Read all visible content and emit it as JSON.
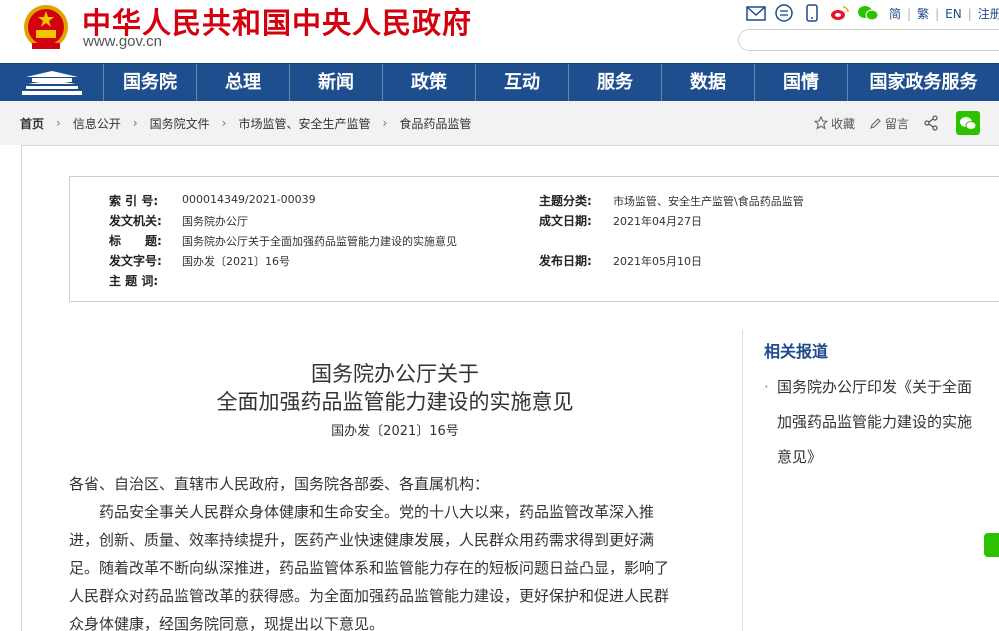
{
  "header": {
    "site_title": "中华人民共和国中央人民政府",
    "site_domain": "www.gov.cn",
    "lang_links": [
      "简",
      "繁",
      "EN",
      "注册"
    ],
    "search_placeholder": ""
  },
  "nav": {
    "items": [
      "国务院",
      "总理",
      "新闻",
      "政策",
      "互动",
      "服务",
      "数据",
      "国情",
      "国家政务服务"
    ]
  },
  "breadcrumb": {
    "items": [
      "首页",
      "信息公开",
      "国务院文件",
      "市场监管、安全生产监管",
      "食品药品监管"
    ],
    "actions": [
      "收藏",
      "留言"
    ]
  },
  "info": {
    "index_label": "索 引 号:",
    "index_value": "000014349/2021-00039",
    "issuer_label": "发文机关:",
    "issuer_value": "国务院办公厅",
    "title_label": "标　　题:",
    "title_value": "国务院办公厅关于全面加强药品监管能力建设的实施意见",
    "docno_label": "发文字号:",
    "docno_value": "国办发〔2021〕16号",
    "keywords_label": "主 题 词:",
    "keywords_value": "",
    "category_label": "主题分类:",
    "category_value": "市场监管、安全生产监管\\食品药品监管",
    "created_label": "成文日期:",
    "created_value": "2021年04月27日",
    "published_label": "发布日期:",
    "published_value": "2021年05月10日"
  },
  "article": {
    "title_line1": "国务院办公厅关于",
    "title_line2": "全面加强药品监管能力建设的实施意见",
    "doc_number": "国办发〔2021〕16号",
    "salutation": "各省、自治区、直辖市人民政府，国务院各部委、各直属机构：",
    "body_lines": [
      "　　药品安全事关人民群众身体健康和生命安全。党的十八大以来，药品监管改革深入推",
      "进，创新、质量、效率持续提升，医药产业快速健康发展，人民群众用药需求得到更好满",
      "足。随着改革不断向纵深推进，药品监管体系和监管能力存在的短板问题日益凸显，影响了",
      "人民群众对药品监管改革的获得感。为全面加强药品监管能力建设，更好保护和促进人民群",
      "众身体健康，经国务院同意，现提出以下意见。"
    ]
  },
  "sidebar": {
    "title": "相关报道",
    "bullet": "·",
    "item_lines": [
      "国务院办公厅印发《关于全面",
      "加强药品监管能力建设的实施",
      "意见》"
    ]
  },
  "colors": {
    "brand_red": "#d3000d",
    "nav_blue": "#1e4e8d",
    "link_blue": "#1f4a8c",
    "wechat_green": "#2dc100"
  }
}
